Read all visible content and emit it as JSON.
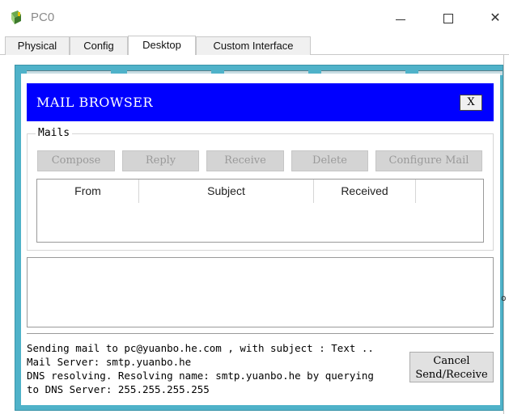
{
  "window": {
    "title": "PC0",
    "icon": "pc-device-icon"
  },
  "tabs": [
    {
      "label": "Physical",
      "active": false
    },
    {
      "label": "Config",
      "active": false
    },
    {
      "label": "Desktop",
      "active": true
    },
    {
      "label": "Custom Interface",
      "active": false
    }
  ],
  "mail_browser": {
    "title": "MAIL BROWSER",
    "close_label": "X",
    "mails_group_label": "Mails",
    "buttons": {
      "compose": "Compose",
      "reply": "Reply",
      "receive": "Receive",
      "delete": "Delete",
      "configure_mail": "Configure Mail"
    },
    "columns": [
      "From",
      "Subject",
      "Received",
      ""
    ],
    "mail_body": "",
    "status_lines": [
      "Sending mail to pc@yuanbo.he.com , with subject : Text ..",
      "Mail Server: smtp.yuanbo.he",
      "DNS resolving. Resolving name: smtp.yuanbo.he by querying",
      "to DNS Server: 255.255.255.255"
    ],
    "cancel_button": {
      "line1": "Cancel",
      "line2": "Send/Receive"
    }
  },
  "colors": {
    "header_blue": "#0000ff",
    "desktop_teal": "#4fb2c9"
  }
}
